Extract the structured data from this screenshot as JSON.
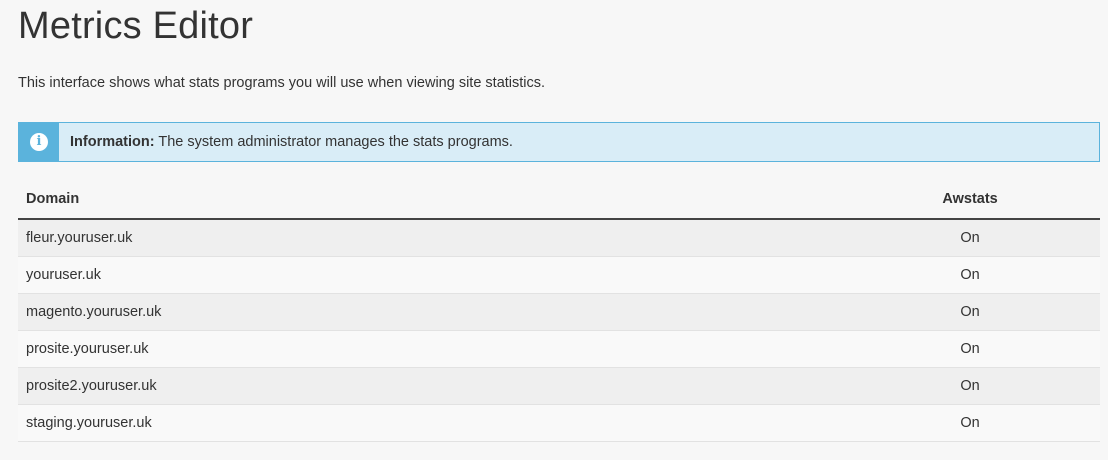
{
  "page": {
    "title": "Metrics Editor",
    "description": "This interface shows what stats programs you will use when viewing site statistics."
  },
  "info_callout": {
    "icon": "info-circle-icon",
    "label": "Information:",
    "message": "The system administrator manages the stats programs.",
    "colors": {
      "background": "#d9edf7",
      "accent": "#5bb3dc"
    }
  },
  "table": {
    "columns": {
      "domain": "Domain",
      "awstats": "Awstats"
    },
    "rows": [
      {
        "domain": "fleur.youruser.uk",
        "awstats": "On"
      },
      {
        "domain": "youruser.uk",
        "awstats": "On"
      },
      {
        "domain": "magento.youruser.uk",
        "awstats": "On"
      },
      {
        "domain": "prosite.youruser.uk",
        "awstats": "On"
      },
      {
        "domain": "prosite2.youruser.uk",
        "awstats": "On"
      },
      {
        "domain": "staging.youruser.uk",
        "awstats": "On"
      }
    ]
  }
}
